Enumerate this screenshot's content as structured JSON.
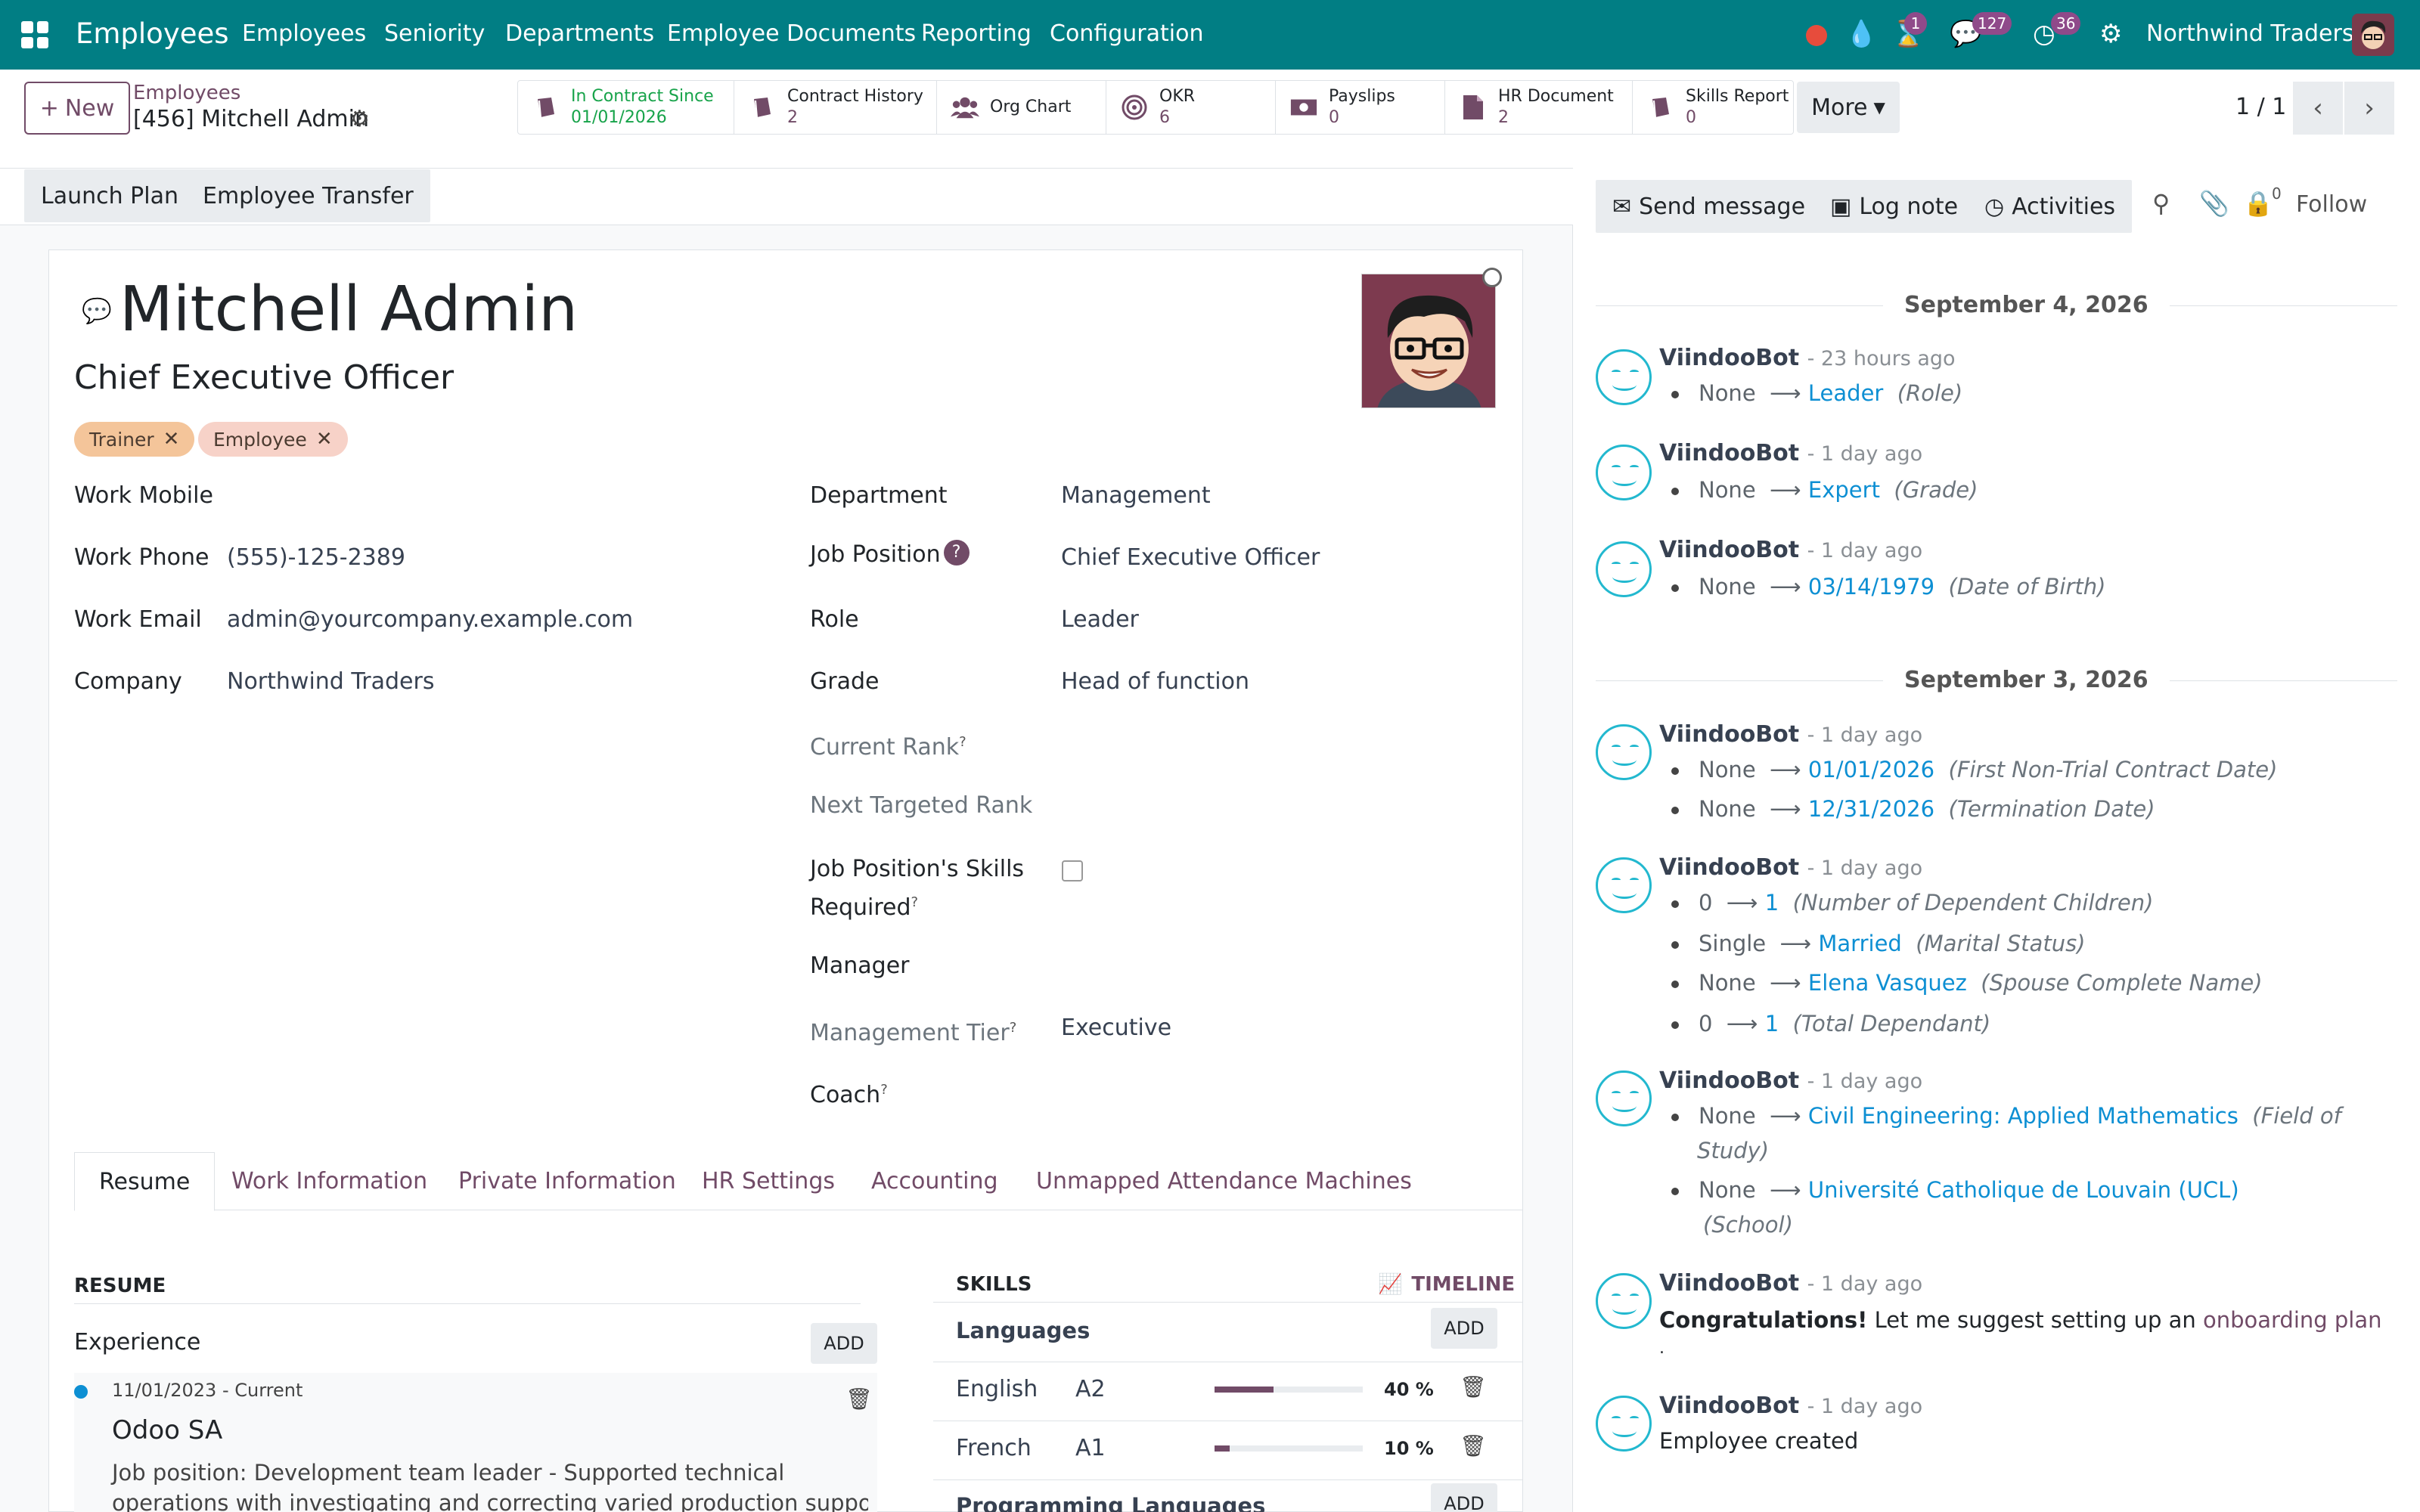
{
  "app": {
    "title": "Employees",
    "menu": [
      "Employees",
      "Seniority",
      "Departments",
      "Employee Documents",
      "Reporting",
      "Configuration"
    ],
    "badges": {
      "activity": "1",
      "messages": "127",
      "clock": "36"
    },
    "company": "Northwind Traders",
    "colors": {
      "topbar": "#017e84",
      "primary": "#714b67",
      "link": "#0d8fd3",
      "success": "#17a34a"
    }
  },
  "control": {
    "new_label": "New",
    "breadcrumb_parent": "Employees",
    "breadcrumb_current": "[456] Mitchell Admin",
    "smart_buttons": [
      {
        "label": "In Contract Since",
        "value": "01/01/2026",
        "icon": "book-icon"
      },
      {
        "label": "Contract History",
        "value": "2",
        "icon": "book-icon"
      },
      {
        "label": "Org Chart",
        "value": "",
        "icon": "users-icon"
      },
      {
        "label": "OKR",
        "value": "6",
        "icon": "target-icon"
      },
      {
        "label": "Payslips",
        "value": "0",
        "icon": "money-icon"
      },
      {
        "label": "HR Document",
        "value": "2",
        "icon": "file-icon"
      },
      {
        "label": "Skills Report",
        "value": "0",
        "icon": "book-icon"
      }
    ],
    "more_label": "More",
    "pager": "1 / 1"
  },
  "statusbar": {
    "buttons": [
      "Launch Plan",
      "Employee Transfer"
    ]
  },
  "employee": {
    "name": "Mitchell Admin",
    "job_title": "Chief Executive Officer",
    "tags": [
      "Trainer",
      "Employee"
    ],
    "tag_colors": [
      "#f4c59a",
      "#f7d2c8"
    ],
    "left_fields": [
      {
        "label": "Work Mobile",
        "value": ""
      },
      {
        "label": "Work Phone",
        "value": "(555)-125-2389"
      },
      {
        "label": "Work Email",
        "value": "admin@yourcompany.example.com"
      },
      {
        "label": "Company",
        "value": "Northwind Traders"
      }
    ],
    "right_fields": {
      "department": {
        "label": "Department",
        "value": "Management"
      },
      "job_position": {
        "label": "Job Position",
        "value": "Chief Executive Officer"
      },
      "role": {
        "label": "Role",
        "value": "Leader"
      },
      "grade": {
        "label": "Grade",
        "value": "Head of function"
      },
      "current_rank": {
        "label": "Current Rank",
        "value": ""
      },
      "next_rank": {
        "label": "Next Targeted Rank",
        "value": ""
      },
      "skills_required": {
        "label_1": "Job Position's Skills",
        "label_2": "Required",
        "checked": false
      },
      "manager": {
        "label": "Manager",
        "value": ""
      },
      "management_tier": {
        "label": "Management Tier",
        "value": "Executive"
      },
      "coach": {
        "label": "Coach",
        "value": ""
      }
    },
    "help_marks": {
      "question": "?",
      "sup": "?"
    }
  },
  "tabs": [
    "Resume",
    "Work Information",
    "Private Information",
    "HR Settings",
    "Accounting",
    "Unmapped Attendance Machines"
  ],
  "resume": {
    "title": "RESUME",
    "experience_label": "Experience",
    "add_label": "ADD",
    "entry": {
      "dates": "11/01/2023 - Current",
      "company": "Odoo SA",
      "desc_1": "Job position: Development team leader - Supported technical",
      "desc_2": "operations with investigating and correcting varied production support"
    }
  },
  "skills": {
    "title": "SKILLS",
    "timeline_label": "TIMELINE",
    "group_languages": "Languages",
    "group_programming": "Programming Languages",
    "add_label": "ADD",
    "rows": [
      {
        "name": "English",
        "level": "A2",
        "progress": 40,
        "progress_label": "40 %"
      },
      {
        "name": "French",
        "level": "A1",
        "progress": 10,
        "progress_label": "10 %"
      }
    ]
  },
  "chatter": {
    "send_message": "Send message",
    "log_note": "Log note",
    "activities": "Activities",
    "followers_count": "0",
    "follow": "Follow",
    "date_1": "September 4, 2026",
    "date_2": "September 3, 2026",
    "author": "ViindooBot",
    "messages": [
      {
        "ago": "- 23 hours ago",
        "tracks": [
          {
            "old": "None",
            "new": "Leader",
            "field": "(Role)"
          }
        ]
      },
      {
        "ago": "- 1 day ago",
        "tracks": [
          {
            "old": "None",
            "new": "Expert",
            "field": "(Grade)"
          }
        ]
      },
      {
        "ago": "- 1 day ago",
        "tracks": [
          {
            "old": "None",
            "new": "03/14/1979",
            "field": "(Date of Birth)"
          }
        ]
      },
      {
        "ago": "- 1 day ago",
        "tracks": [
          {
            "old": "None",
            "new": "01/01/2026",
            "field": "(First Non-Trial Contract Date)"
          },
          {
            "old": "None",
            "new": "12/31/2026",
            "field": "(Termination Date)"
          }
        ]
      },
      {
        "ago": "- 1 day ago",
        "tracks": [
          {
            "old": "0",
            "new": "1",
            "field": "(Number of Dependent Children)"
          },
          {
            "old": "Single",
            "new": "Married",
            "field": "(Marital Status)"
          },
          {
            "old": "None",
            "new": "Elena Vasquez",
            "field": "(Spouse Complete Name)"
          },
          {
            "old": "0",
            "new": "1",
            "field": "(Total Dependant)"
          }
        ]
      },
      {
        "ago": "- 1 day ago",
        "tracks": [
          {
            "old": "None",
            "new": "Civil Engineering: Applied Mathematics",
            "field": "(Field of",
            "field_2": "Study)"
          },
          {
            "old": "None",
            "new": "Université Catholique de Louvain (UCL)",
            "field": "",
            "field_2": "(School)"
          }
        ]
      },
      {
        "ago": "- 1 day ago",
        "bold": "Congratulations!",
        "text": "Let me suggest setting up an",
        "link": "onboarding plan",
        "trail": "."
      },
      {
        "ago": "- 1 day ago",
        "text": "Employee created"
      }
    ]
  }
}
